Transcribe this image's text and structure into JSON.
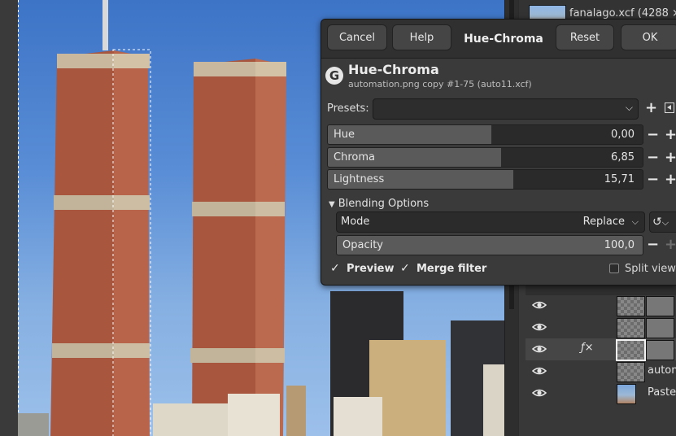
{
  "image_tab": {
    "label": "fanalago.xcf (4288 ×"
  },
  "dialog": {
    "buttons": {
      "cancel": "Cancel",
      "help": "Help",
      "reset": "Reset",
      "ok": "OK"
    },
    "title": "Hue-Chroma",
    "logo": "G",
    "tool_title": "Hue-Chroma",
    "tool_subtitle": "automation.png copy #1-75 (auto11.xcf)",
    "presets": {
      "label": "Presets:",
      "value": ""
    },
    "sliders": [
      {
        "label": "Hue",
        "value": "0,00",
        "fill_fraction": 0.52
      },
      {
        "label": "Chroma",
        "value": "6,85",
        "fill_fraction": 0.55
      },
      {
        "label": "Lightness",
        "value": "15,71",
        "fill_fraction": 0.59
      }
    ],
    "blending": {
      "header": "Blending Options",
      "mode_label": "Mode",
      "mode_value": "Replace",
      "opacity_label": "Opacity",
      "opacity_value": "100,0",
      "opacity_fill_fraction": 1.0
    },
    "preview_label": "Preview",
    "preview_checked": true,
    "merge_label": "Merge filter",
    "merge_checked": true,
    "split_label": "Split view",
    "split_checked": false
  },
  "layers": [
    {
      "name": "",
      "has_fx": false,
      "selected": false,
      "visible": true
    },
    {
      "name": "",
      "has_fx": false,
      "selected": false,
      "visible": true
    },
    {
      "name": "",
      "has_fx": true,
      "fx_symbol": "ƒ×",
      "selected": true,
      "visible": true
    },
    {
      "name": "autom",
      "has_fx": false,
      "selected": false,
      "visible": true
    },
    {
      "name": "Pasted",
      "has_fx": false,
      "selected": false,
      "visible": true
    }
  ],
  "colors": {
    "sky": "#5a8ed6",
    "brick": "#a85a45",
    "dialog_bg": "#3a3a3a",
    "panel_bg": "#383838"
  }
}
